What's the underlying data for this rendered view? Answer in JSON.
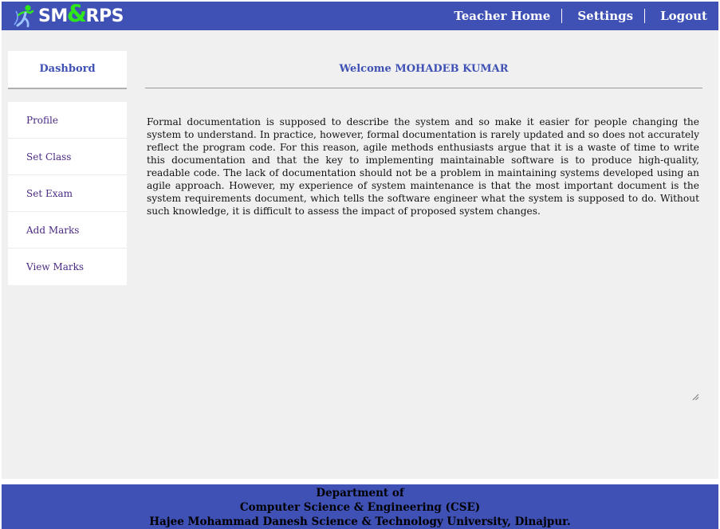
{
  "header": {
    "logo": {
      "text_left": "SM",
      "text_amp": "&",
      "text_right": "RPS",
      "icon": "running-person-icon"
    },
    "nav": [
      {
        "label": "Teacher Home"
      },
      {
        "label": "Settings"
      },
      {
        "label": "Logout"
      }
    ]
  },
  "sidebar": {
    "title": "Dashbord",
    "items": [
      {
        "label": "Profile"
      },
      {
        "label": "Set Class"
      },
      {
        "label": "Set Exam"
      },
      {
        "label": "Add Marks"
      },
      {
        "label": "View Marks"
      }
    ]
  },
  "main": {
    "welcome": "Welcome MOHADEB KUMAR",
    "body": "Formal documentation is supposed to describe the system and so make it easier for people changing the system to understand. In practice, however, formal documentation is rarely updated and so does not accurately reflect the program code. For this reason, agile methods enthusiasts argue that it is a waste of time to write this documentation and that the key to implementing maintainable software is to produce high-quality, readable code. The lack of documentation should not be a problem in maintaining systems developed using an agile approach. However, my experience of system maintenance is that the most important document is the system requirements document, which tells the software engineer what the system is supposed to do. Without such knowledge, it is difficult to assess the impact of proposed system changes."
  },
  "footer": {
    "line1": "Department of",
    "line2": "Computer Science & Engineering (CSE)",
    "line3": "Hajee Mohammad Danesh Science & Technology University, Dinajpur."
  },
  "colors": {
    "brand": "#3f51b5",
    "logo_accent": "#2ee619",
    "sidebar_link": "#4a2a82",
    "content_bg": "#f0f0f0"
  }
}
